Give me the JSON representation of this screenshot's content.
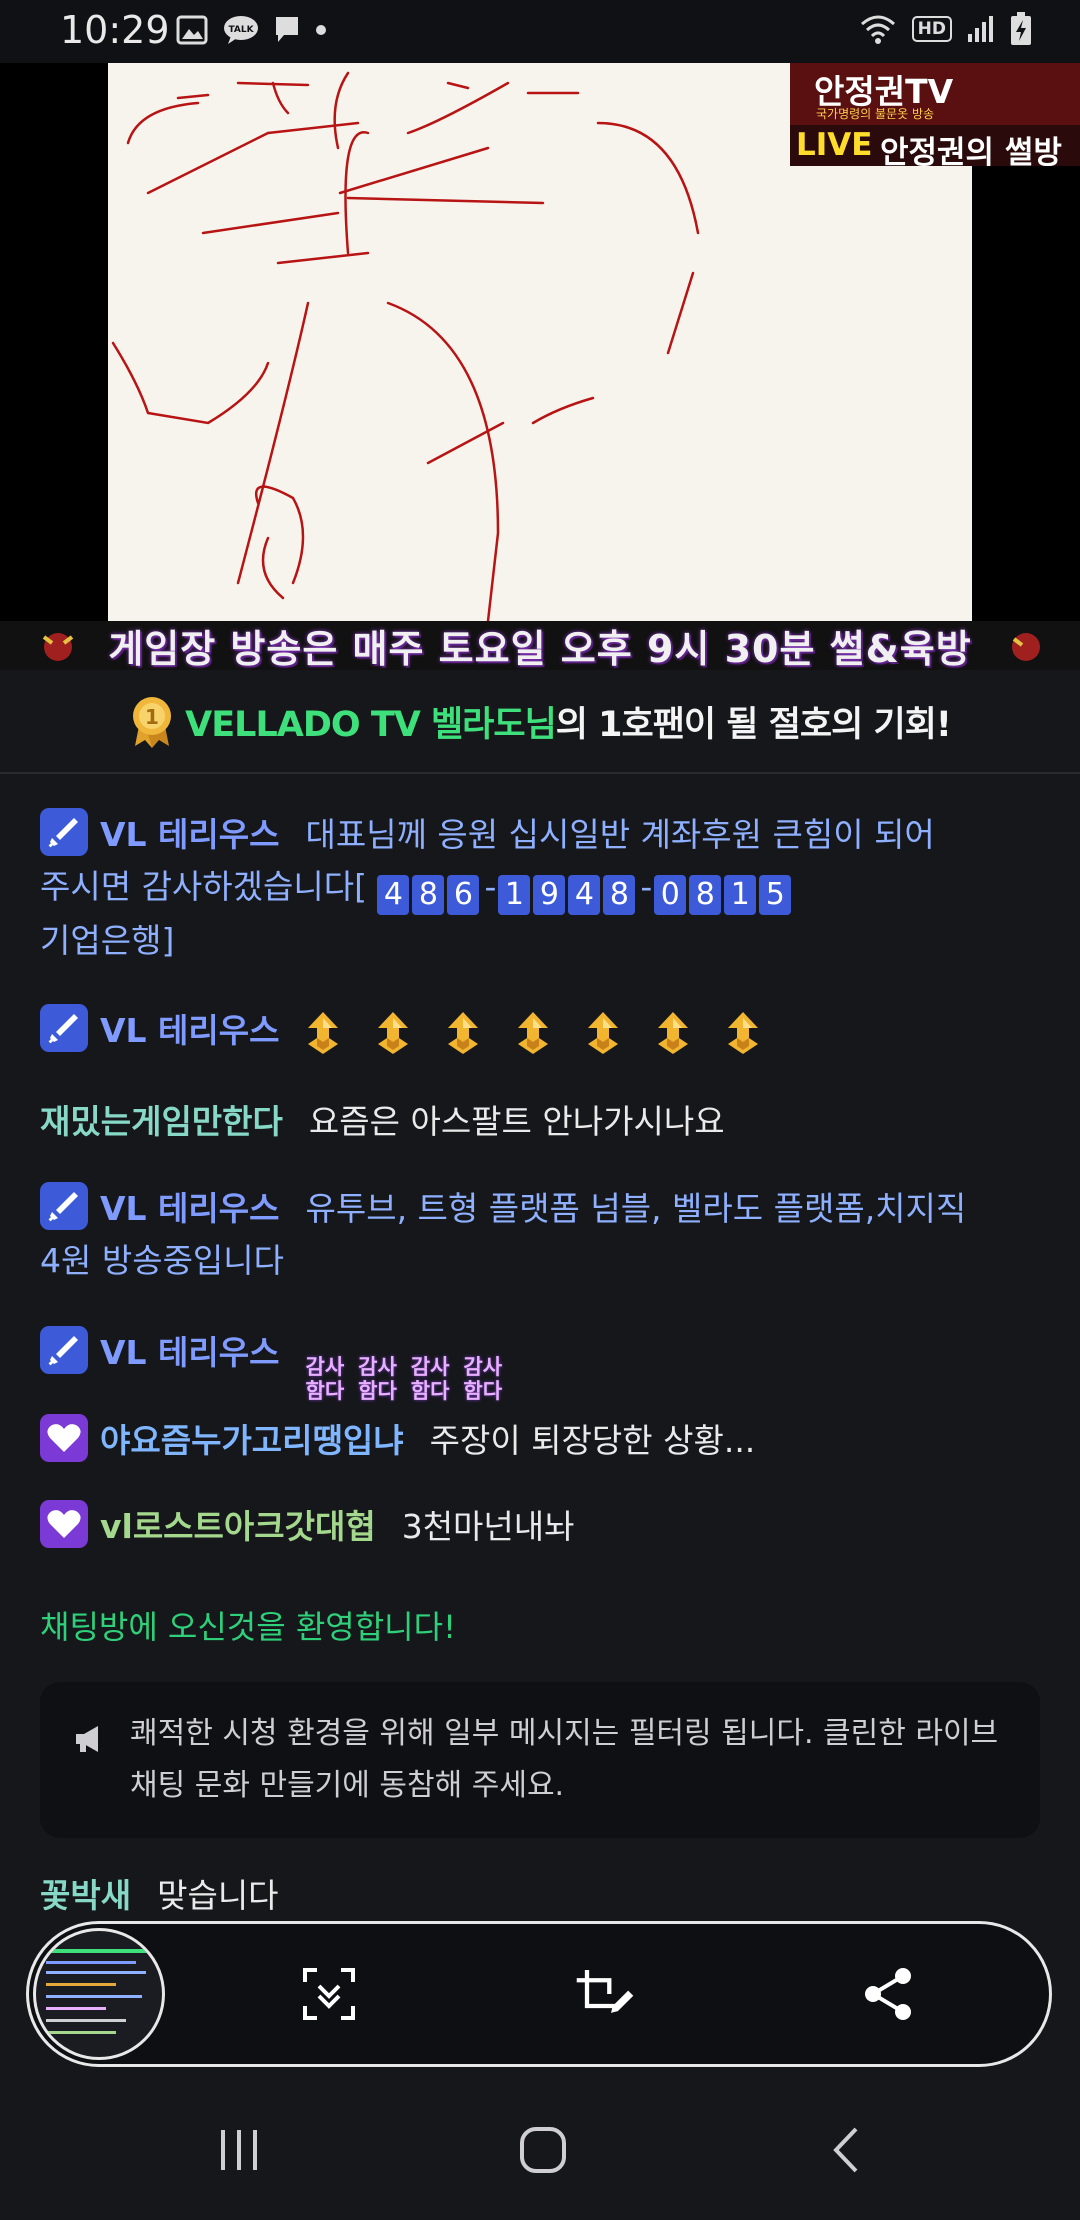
{
  "status_bar": {
    "time": "10:29",
    "icons_left": [
      "image-icon",
      "talk-icon",
      "message-icon",
      "dot-icon"
    ],
    "talk_label": "TALK",
    "hd_label": "HD",
    "icons_right": [
      "wifi-icon",
      "hd-icon",
      "signal-icon",
      "battery-charging-icon"
    ]
  },
  "video": {
    "channel_logo_title": "안정권TV",
    "channel_logo_subtitle": "국가명령의 불문옷 방송",
    "live_label": "LIVE",
    "live_title": "안정권의 썰방",
    "ticker": "게임장 방송은 매주 토요일 오후 9시 30분 썰&육방"
  },
  "banner": {
    "name": "VELLADO TV 벨라도님",
    "text": "의 1호팬이 될 절호의 기회!"
  },
  "chat": {
    "messages": [
      {
        "nick": "VL 테리우스",
        "text_line1": "대표님께 응원 십시일반 계좌후원 큰힘이 되어",
        "text_line2": "주시면 감사하겠습니다[",
        "account_groups": [
          "486",
          "1948",
          "0815"
        ],
        "text_line3": "기업은행]"
      },
      {
        "nick": "VL 테리우스",
        "emoji": "up-arrow-emoji",
        "emoji_count": 7
      },
      {
        "nick": "재밌는게임만한다",
        "text": "요즘은 아스팔트 안나가시나요"
      },
      {
        "nick": "VL 테리우스",
        "text_line1": "유투브, 트형 플랫폼 넘블, 벨라도 플랫폼,치지직",
        "text_line2": "4원 방송중입니다"
      },
      {
        "nick": "VL 테리우스",
        "emote_top": "감사",
        "emote_bottom": "함다",
        "emote_count": 4
      },
      {
        "nick": "야요즘누가고리땡입냐",
        "text": "주장이 퇴장당한 상황..."
      },
      {
        "nick": "vl로스트아크갓대협",
        "text": "3천마넌내놔"
      }
    ],
    "welcome": "채팅방에 오신것을 환영합니다!",
    "notice": "쾌적한 시청 환경을 위해 일부 메시지는 필터링 됩니다. 클린한 라이브 채팅 문화 만들기에 동참해 주세요.",
    "last_message": {
      "nick": "꽃박새",
      "text": "맞습니다"
    }
  },
  "toolbar": {
    "items": [
      "screenshot-thumbnail",
      "scroll-capture-icon",
      "crop-edit-icon",
      "share-icon"
    ]
  },
  "navbar": {
    "items": [
      "recent-apps-icon",
      "home-icon",
      "back-icon"
    ]
  },
  "colors": {
    "accent_green": "#3ee07c",
    "nick_blue": "#7f9bff",
    "badge_blue": "#3d5bd9",
    "badge_purple": "#7b3ad6",
    "welcome_green": "#2fd07a"
  }
}
